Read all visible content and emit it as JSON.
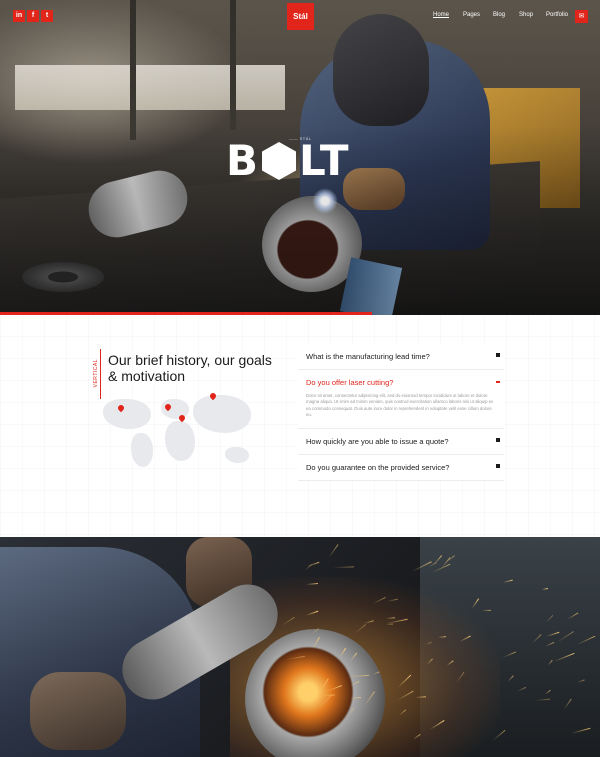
{
  "header": {
    "social": [
      {
        "icon": "linkedin-icon",
        "glyph": "in"
      },
      {
        "icon": "facebook-icon",
        "glyph": "f"
      },
      {
        "icon": "twitter-icon",
        "glyph": "t"
      }
    ],
    "logo": "Stál",
    "nav": [
      "Home",
      "Pages",
      "Blog",
      "Shop",
      "Portfolio"
    ],
    "mail_icon": "mail-icon",
    "accent": "#e1251b"
  },
  "hero": {
    "small_caption": "—— STÁL",
    "brand_left": "B",
    "brand_right": "LT"
  },
  "about": {
    "tag": "VERTICAL",
    "title": "Our brief history, our goals & motivation"
  },
  "faq": [
    {
      "q": "What is the manufacturing lead time?",
      "open": false
    },
    {
      "q": "Do you offer laser cutting?",
      "open": true,
      "a": "Dolor sit amet, consectetur adipisicing elit, sed do eiusmod tempor incididunt ut labore et dolore magna aliqua. Ut enim ad minim veniam, quis nostrud exercitation ullamco laboris nisi ut aliquip ex ea commodo consequat. Duis aute irure dolor in reprehenderit in voluptate velit esse cillum dolore eu."
    },
    {
      "q": "How quickly are you able to issue a quote?",
      "open": false
    },
    {
      "q": "Do you guarantee on the provided service?",
      "open": false
    }
  ]
}
